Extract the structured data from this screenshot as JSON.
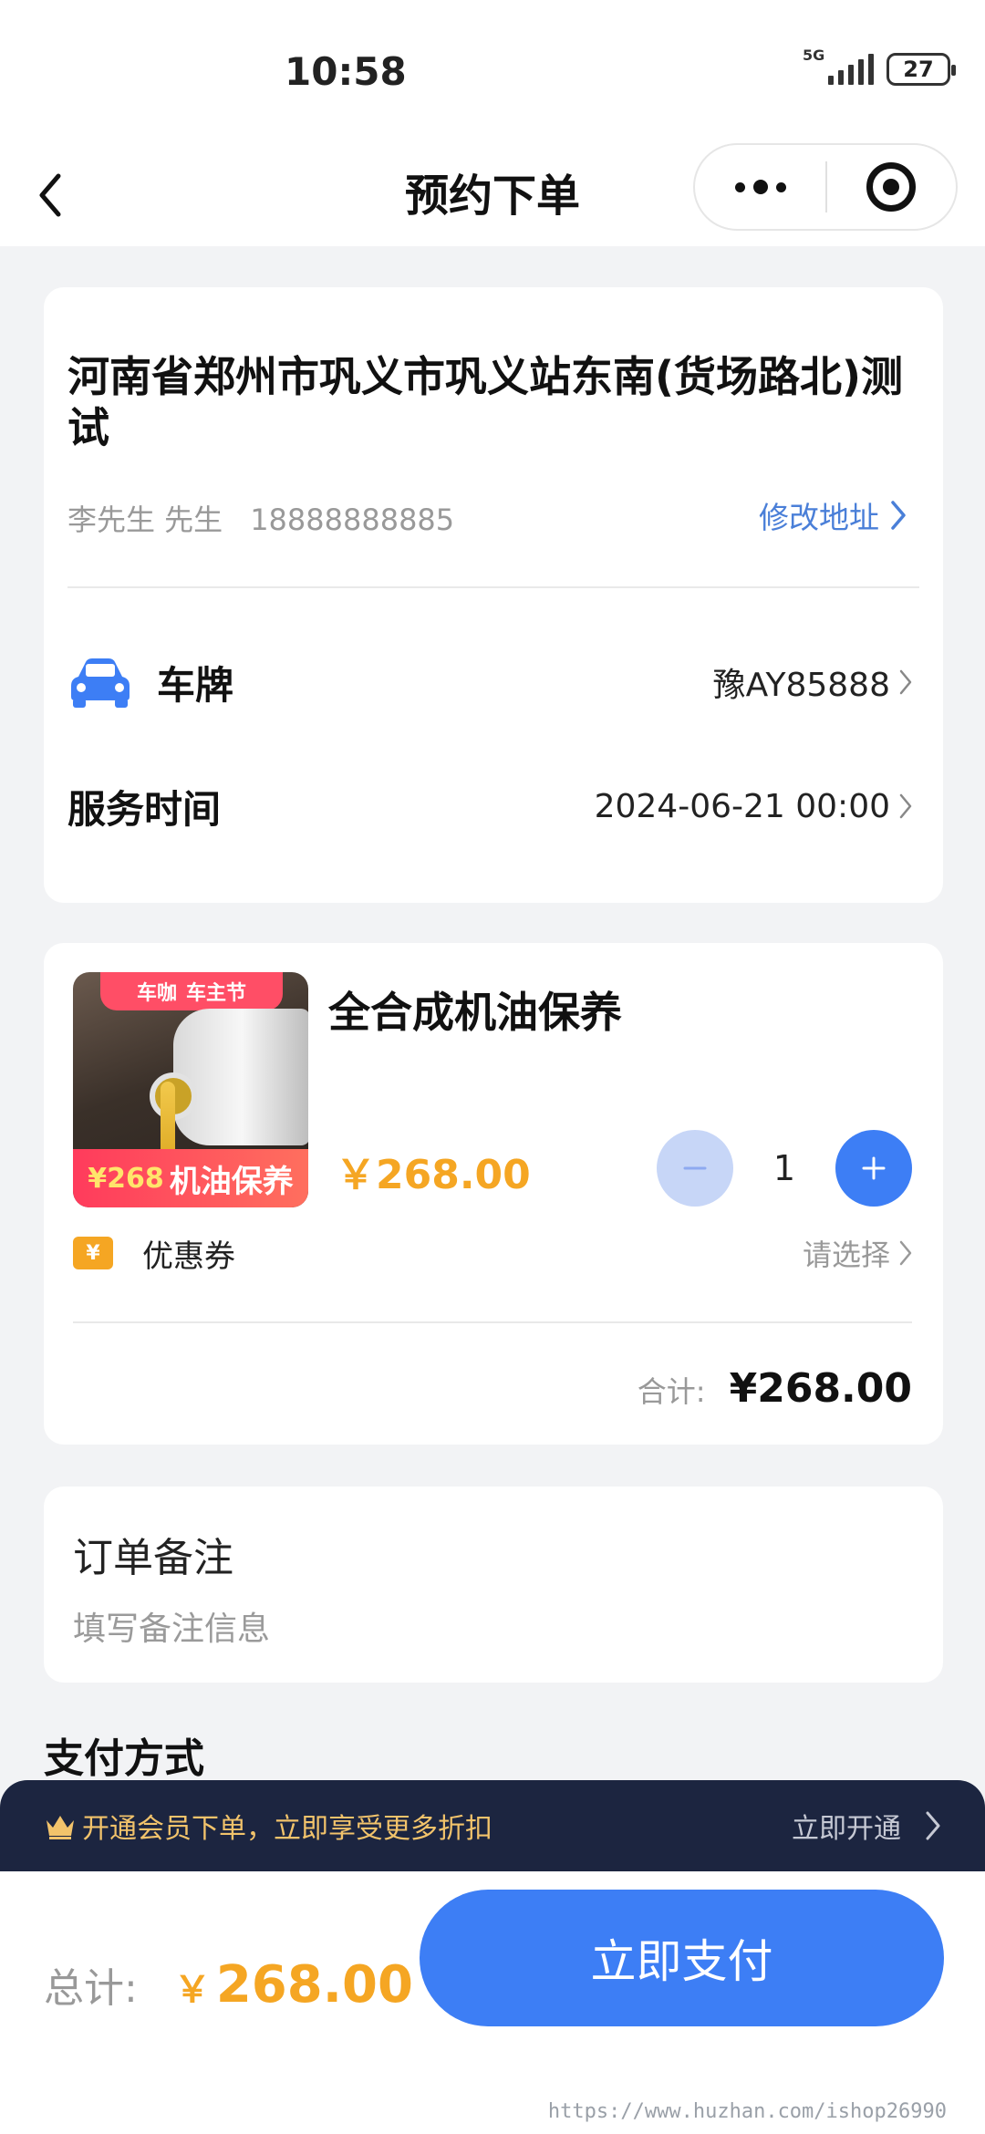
{
  "status_bar": {
    "time": "10:58",
    "network": "5G",
    "battery": "27"
  },
  "nav": {
    "title": "预约下单"
  },
  "address": {
    "line": "河南省郑州市巩义市巩义站东南(货场路北)测试",
    "contact_name": "李先生 先生",
    "phone": "18888888885",
    "edit_label": "修改地址"
  },
  "service": {
    "plate_label": "车牌",
    "plate_value": "豫AY85888",
    "time_label": "服务时间",
    "time_value": "2024-06-21 00:00"
  },
  "product": {
    "image_banner_brand": "车咖",
    "image_banner_event": "车主节",
    "image_price": "¥268",
    "image_text": "机油保养",
    "name": "全合成机油保养",
    "price": "￥268.00",
    "quantity": "1",
    "coupon_label": "优惠券",
    "coupon_select": "请选择",
    "total_label": "合计:",
    "total_amount": "¥268.00"
  },
  "remark": {
    "title": "订单备注",
    "placeholder": "填写备注信息"
  },
  "payment": {
    "title": "支付方式"
  },
  "member": {
    "message": "开通会员下单，立即享受更多折扣",
    "action": "立即开通"
  },
  "footer": {
    "total_label": "总计:",
    "currency": "￥",
    "amount": "268.00",
    "pay_button": "立即支付",
    "watermark": "https://www.huzhan.com/ishop26990"
  },
  "colors": {
    "accent": "#3d7ef5",
    "price": "#f5a623",
    "member_bar": "#1c2540"
  }
}
